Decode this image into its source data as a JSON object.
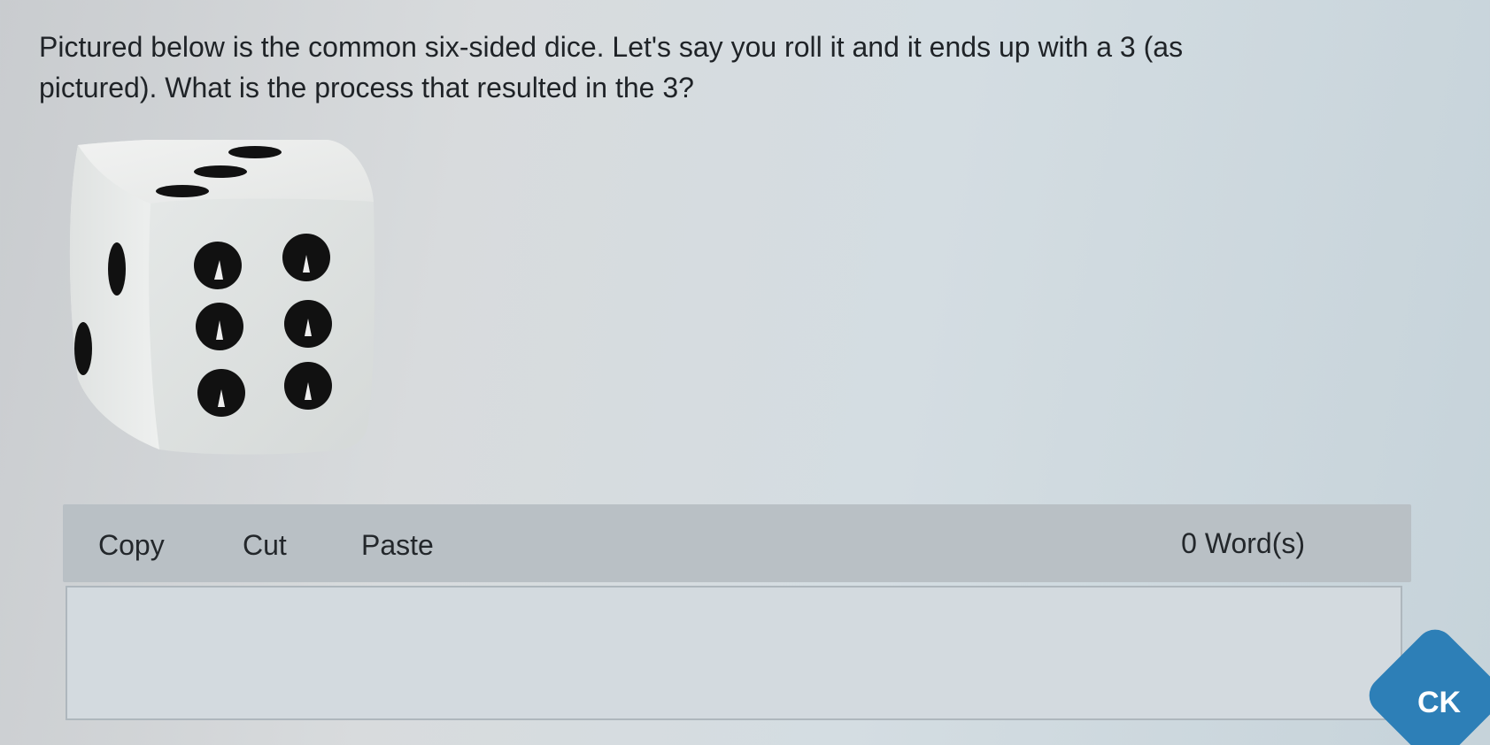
{
  "question": {
    "text": "Pictured below is the common six-sided dice. Let's say you roll it and it ends up with a 3 (as pictured). What is the process that resulted in the 3?"
  },
  "image": {
    "subject": "six-sided-die",
    "top_face_value": 3,
    "front_face_value": 6,
    "side_face_value": 2
  },
  "editor": {
    "toolbar": {
      "copy_label": "Copy",
      "cut_label": "Cut",
      "paste_label": "Paste",
      "word_count": "0 Word(s)"
    },
    "answer": {
      "value": "",
      "placeholder": ""
    }
  },
  "badge": {
    "label": "CK",
    "color": "#2d7fb7"
  },
  "colors": {
    "background": "#d4dbe0",
    "toolbar": "#b9c0c5",
    "text": "#1f2327"
  }
}
